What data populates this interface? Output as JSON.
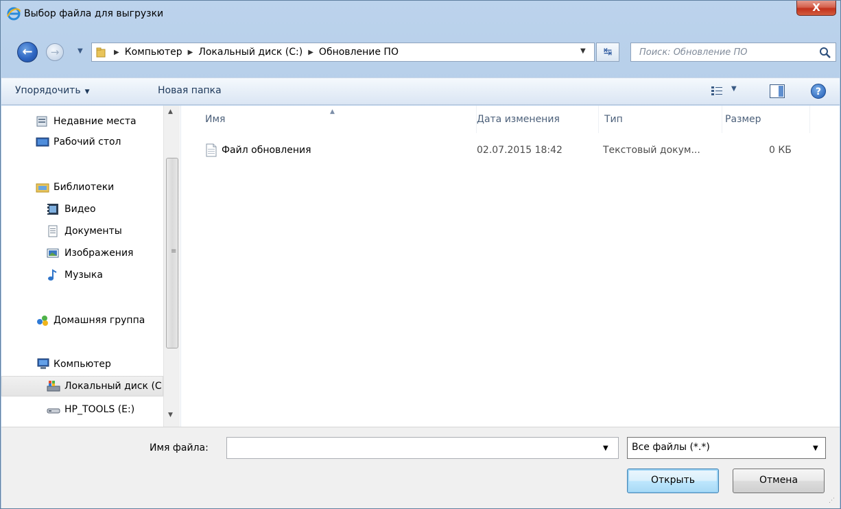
{
  "window": {
    "title": "Выбор файла для выгрузки",
    "close_label": "X"
  },
  "nav": {
    "breadcrumbs": [
      "Компьютер",
      "Локальный диск (C:)",
      "Обновление ПО"
    ],
    "search_placeholder": "Поиск: Обновление ПО"
  },
  "toolbar": {
    "organize_label": "Упорядочить",
    "new_folder_label": "Новая папка"
  },
  "sidebar": {
    "items": [
      {
        "label": "Недавние места",
        "icon": "recent-places-icon"
      },
      {
        "label": "Рабочий стол",
        "icon": "desktop-icon"
      },
      {
        "label": "Библиотеки",
        "icon": "libraries-icon"
      },
      {
        "label": "Видео",
        "icon": "video-icon"
      },
      {
        "label": "Документы",
        "icon": "documents-icon"
      },
      {
        "label": "Изображения",
        "icon": "images-icon"
      },
      {
        "label": "Музыка",
        "icon": "music-icon"
      },
      {
        "label": "Домашняя группа",
        "icon": "homegroup-icon"
      },
      {
        "label": "Компьютер",
        "icon": "computer-icon"
      },
      {
        "label": "Локальный диск (C:)",
        "icon": "local-disk-icon",
        "selected": true
      },
      {
        "label": "HP_TOOLS (E:)",
        "icon": "drive-icon"
      }
    ]
  },
  "files": {
    "columns": [
      "Имя",
      "Дата изменения",
      "Тип",
      "Размер"
    ],
    "rows": [
      {
        "name": "Файл обновления",
        "date": "02.07.2015 18:42",
        "type": "Текстовый докум...",
        "size": "0 КБ",
        "icon": "text-document-icon"
      }
    ]
  },
  "footer": {
    "filename_label": "Имя файла:",
    "filename_value": "",
    "filetype_value": "Все файлы (*.*)",
    "open_label": "Открыть",
    "cancel_label": "Отмена"
  },
  "colors": {
    "accent": "#3c7fb1",
    "close": "#c2311c",
    "frame": "#bcd3ec"
  }
}
